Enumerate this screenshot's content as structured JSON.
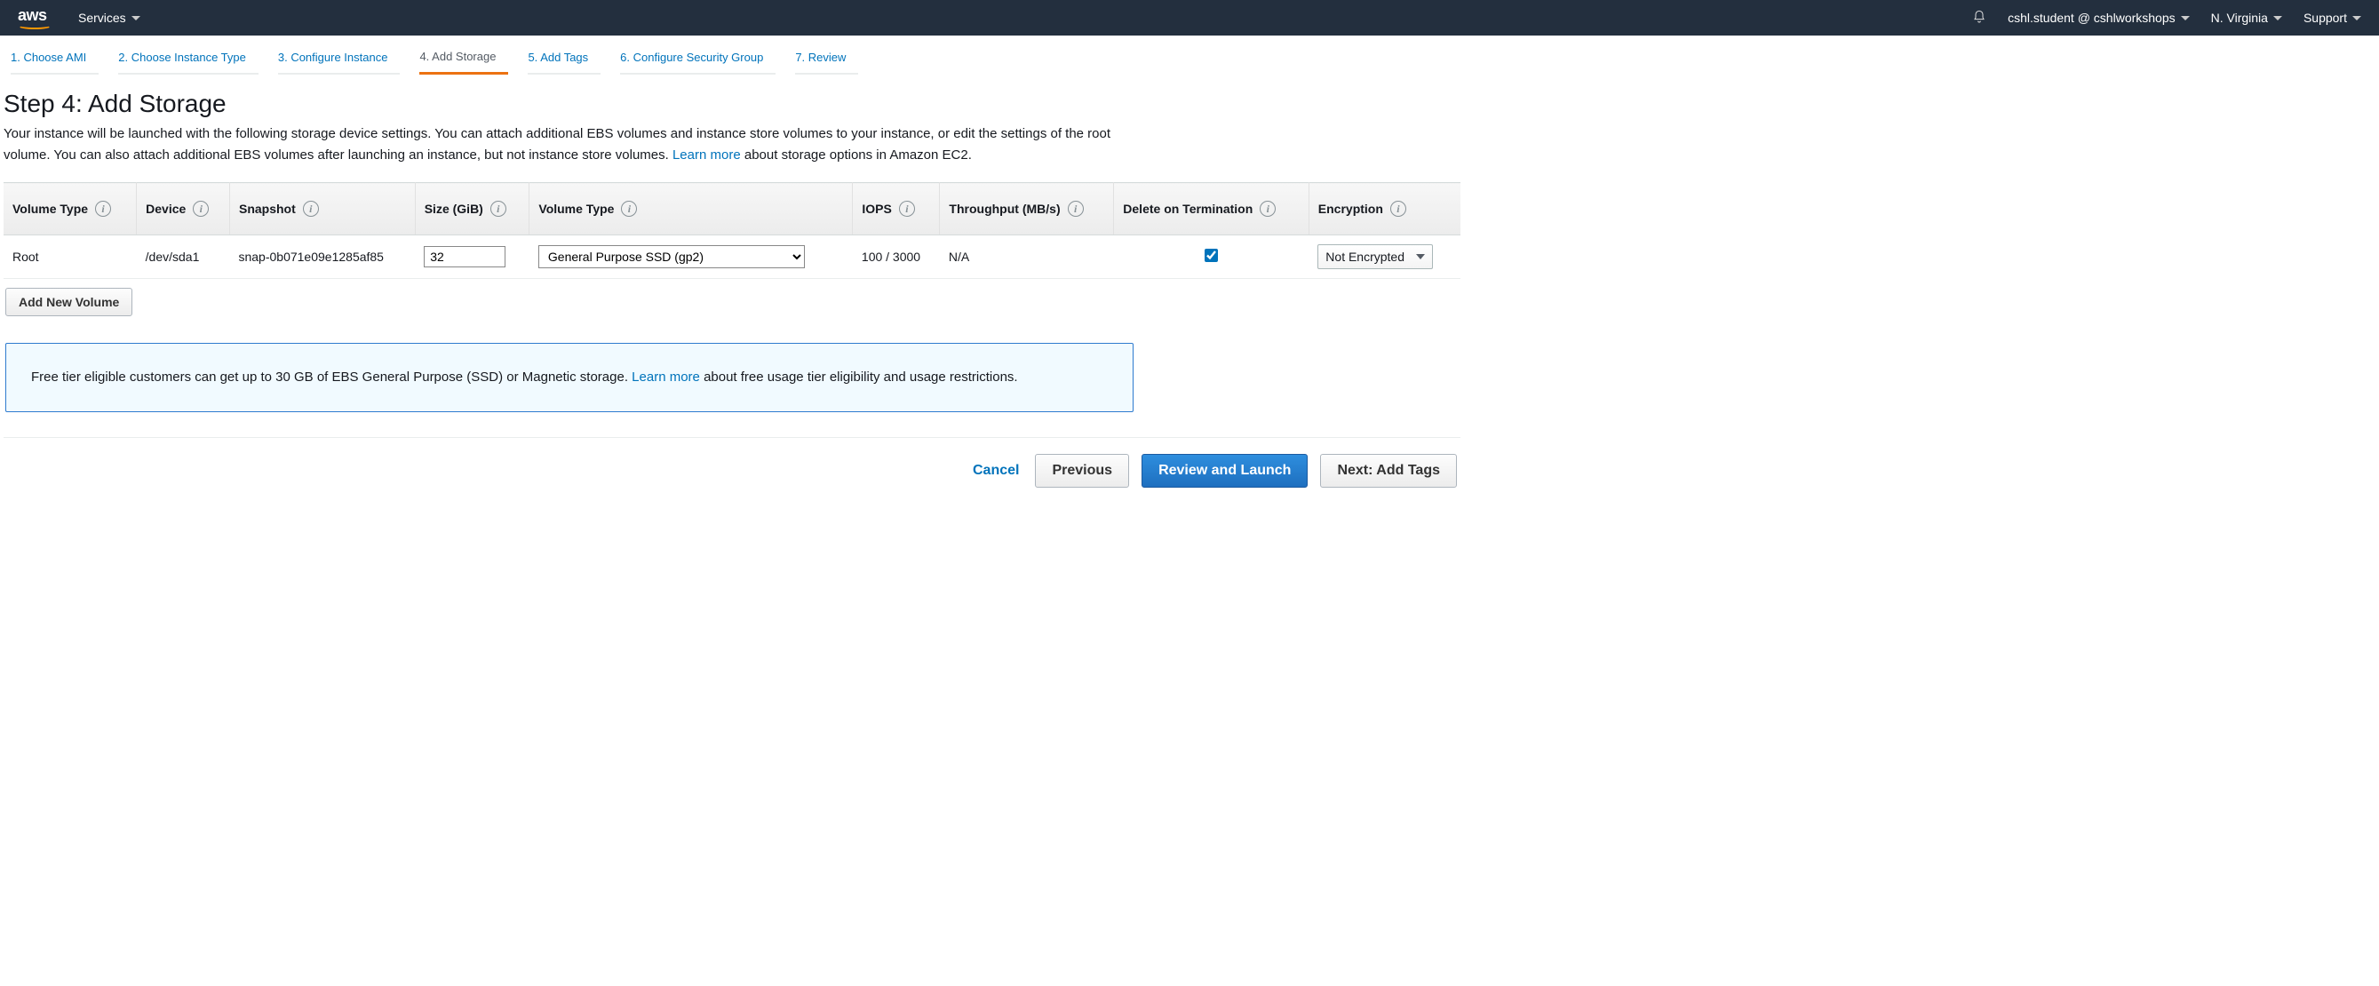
{
  "nav": {
    "services_label": "Services",
    "account_label": "cshl.student @ cshlworkshops",
    "region_label": "N. Virginia",
    "support_label": "Support"
  },
  "wizard": {
    "steps": [
      {
        "label": "1. Choose AMI",
        "current": false
      },
      {
        "label": "2. Choose Instance Type",
        "current": false
      },
      {
        "label": "3. Configure Instance",
        "current": false
      },
      {
        "label": "4. Add Storage",
        "current": true
      },
      {
        "label": "5. Add Tags",
        "current": false
      },
      {
        "label": "6. Configure Security Group",
        "current": false
      },
      {
        "label": "7. Review",
        "current": false
      }
    ]
  },
  "page": {
    "title": "Step 4: Add Storage",
    "intro_a": "Your instance will be launched with the following storage device settings. You can attach additional EBS volumes and instance store volumes to your instance, or edit the settings of the root volume. You can also attach additional EBS volumes after launching an instance, but not instance store volumes. ",
    "learn_more": "Learn more",
    "intro_b": " about storage options in Amazon EC2."
  },
  "table": {
    "headers": {
      "volume_type_kind": "Volume Type",
      "device": "Device",
      "snapshot": "Snapshot",
      "size": "Size (GiB)",
      "volume_type": "Volume Type",
      "iops": "IOPS",
      "throughput": "Throughput (MB/s)",
      "delete_on_term": "Delete on Termination",
      "encryption": "Encryption"
    },
    "row": {
      "kind": "Root",
      "device": "/dev/sda1",
      "snapshot": "snap-0b071e09e1285af85",
      "size_value": "32",
      "volume_type_value": "General Purpose SSD (gp2)",
      "iops": "100 / 3000",
      "throughput": "N/A",
      "delete_on_term": true,
      "encryption_value": "Not Encrypted"
    },
    "add_volume_label": "Add New Volume"
  },
  "infobox": {
    "text_a": "Free tier eligible customers can get up to 30 GB of EBS General Purpose (SSD) or Magnetic storage. ",
    "learn_more": "Learn more",
    "text_b": " about free usage tier eligibility and usage restrictions."
  },
  "footer": {
    "cancel": "Cancel",
    "previous": "Previous",
    "review": "Review and Launch",
    "next": "Next: Add Tags"
  }
}
